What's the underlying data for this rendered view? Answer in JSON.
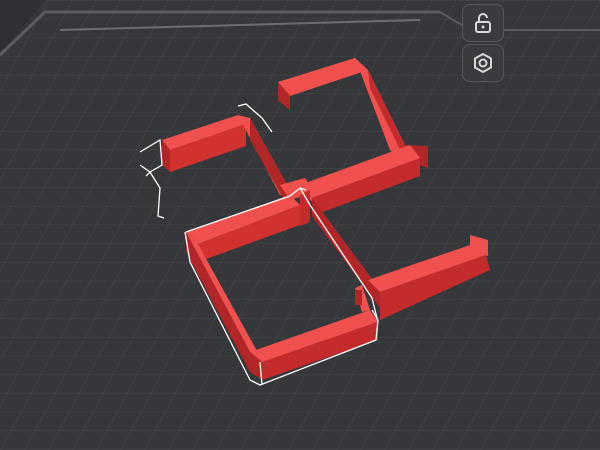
{
  "viewport": {
    "background": "#2f3033",
    "grid_color": "#4a4c50",
    "grid_major_color": "#5a5c61",
    "model_color": "#e0393a",
    "model_side_color": "#b32628",
    "model_top_color": "#f0504e",
    "selection_outline_color": "#ffffff"
  },
  "toolbar": {
    "buttons": [
      {
        "icon": "lock-open-icon",
        "state": "unlocked"
      },
      {
        "icon": "hexagon-nut-icon",
        "state": "default"
      }
    ]
  }
}
